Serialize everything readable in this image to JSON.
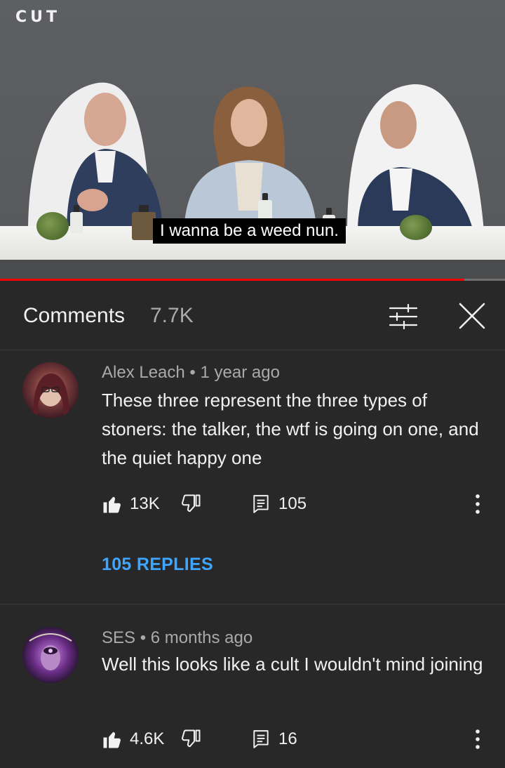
{
  "video": {
    "logo": "CUT",
    "caption": "I wanna be a weed nun.",
    "progress": 0.92
  },
  "comments_header": {
    "title": "Comments",
    "count": "7.7K"
  },
  "comments": [
    {
      "author": "Alex Leach",
      "time": "1 year ago",
      "text": "These three represent the three types of stoners: the talker, the wtf is going on one, and the quiet happy one",
      "likes": "13K",
      "reply_count": "105",
      "replies_link": "105 REPLIES"
    },
    {
      "author": "SES",
      "time": "6 months ago",
      "text": "Well this looks like a cult I wouldn't mind joining",
      "likes": "4.6K",
      "reply_count": "16"
    }
  ],
  "colors": {
    "background": "#282828",
    "accent_link": "#3ea6ff",
    "progress": "#ff0000"
  },
  "icons": [
    "sort-icon",
    "close-icon",
    "thumbs-up-icon",
    "thumbs-down-icon",
    "reply-icon",
    "more-vert-icon"
  ]
}
